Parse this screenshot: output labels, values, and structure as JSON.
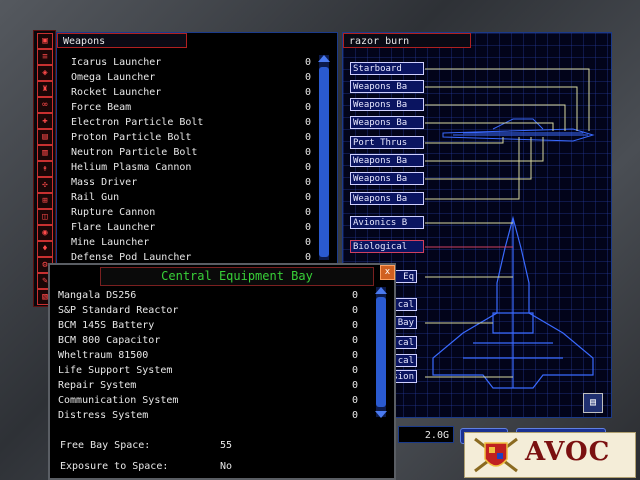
{
  "weapons_panel": {
    "title": "Weapons",
    "items": [
      {
        "name": "Icarus Launcher",
        "qty": "0"
      },
      {
        "name": "Omega Launcher",
        "qty": "0"
      },
      {
        "name": "Rocket Launcher",
        "qty": "0"
      },
      {
        "name": "Force Beam",
        "qty": "0"
      },
      {
        "name": "Electron Particle Bolt",
        "qty": "0"
      },
      {
        "name": "Proton Particle Bolt",
        "qty": "0"
      },
      {
        "name": "Neutron Particle Bolt",
        "qty": "0"
      },
      {
        "name": "Helium Plasma Cannon",
        "qty": "0"
      },
      {
        "name": "Mass Driver",
        "qty": "0"
      },
      {
        "name": "Rail Gun",
        "qty": "0"
      },
      {
        "name": "Rupture Cannon",
        "qty": "0"
      },
      {
        "name": "Flare Launcher",
        "qty": "0"
      },
      {
        "name": "Mine Launcher",
        "qty": "0"
      },
      {
        "name": "Defense Pod Launcher",
        "qty": "0"
      }
    ]
  },
  "ship_panel": {
    "title": "razor burn",
    "slots": [
      {
        "label": "Starboard",
        "style": "blue"
      },
      {
        "label": "Weapons Ba",
        "style": "blue"
      },
      {
        "label": "Weapons Ba",
        "style": "blue"
      },
      {
        "label": "Weapons Ba",
        "style": "blue"
      },
      {
        "label": "Port Thrus",
        "style": "blue"
      },
      {
        "label": "Weapons Ba",
        "style": "blue"
      },
      {
        "label": "Weapons Ba",
        "style": "blue"
      },
      {
        "label": "Weapons Ba",
        "style": "blue"
      },
      {
        "label": "Avionics B",
        "style": "blue"
      },
      {
        "label": "Biological",
        "style": "red"
      },
      {
        "label": "Eq",
        "style": "cut"
      },
      {
        "label": "cal",
        "style": "cut"
      },
      {
        "label": "Bay",
        "style": "cut"
      },
      {
        "label": "cal",
        "style": "cut"
      },
      {
        "label": "cal",
        "style": "cut"
      },
      {
        "label": "sion",
        "style": "cut"
      }
    ]
  },
  "popup": {
    "title": "Central Equipment Bay",
    "close_label": "x",
    "items": [
      {
        "name": "Mangala DS256",
        "qty": "0"
      },
      {
        "name": "S&P Standard Reactor",
        "qty": "0"
      },
      {
        "name": "BCM 145S Battery",
        "qty": "0"
      },
      {
        "name": "BCM 800 Capacitor",
        "qty": "0"
      },
      {
        "name": "Wheltraum 81500",
        "qty": "0"
      },
      {
        "name": "Life Support System",
        "qty": "0"
      },
      {
        "name": "Repair System",
        "qty": "0"
      },
      {
        "name": "Communication System",
        "qty": "0"
      },
      {
        "name": "Distress System",
        "qty": "0"
      }
    ],
    "free_bay_label": "Free Bay Space:",
    "free_bay_value": "55",
    "exposure_label": "Exposure to Space:",
    "exposure_value": "No"
  },
  "bottom": {
    "readout": "2.0G",
    "button1": "R",
    "button2": "R"
  },
  "logo": {
    "text": "AVOC"
  },
  "toolbar_icons": [
    "ship-icon",
    "radar-icon",
    "wing-icon",
    "turret-icon",
    "engine-icon",
    "shield-icon",
    "cargo-icon",
    "pod-icon",
    "missile-icon",
    "armor-icon",
    "bay-icon",
    "laser-icon",
    "crew-icon",
    "sensor-icon",
    "config-icon",
    "hull-icon",
    "weapon-icon"
  ]
}
